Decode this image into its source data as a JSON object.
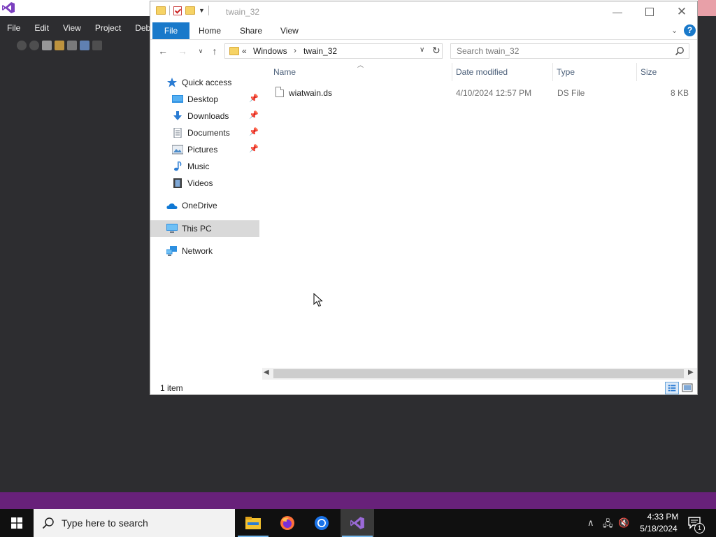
{
  "vs": {
    "menu": [
      "File",
      "Edit",
      "View",
      "Project",
      "Debu"
    ]
  },
  "explorer": {
    "title": "twain_32",
    "ribbon_tabs": [
      "File",
      "Home",
      "Share",
      "View"
    ],
    "help": "?",
    "address": {
      "overflow": "«",
      "segments": [
        "Windows",
        "twain_32"
      ],
      "separator": "›"
    },
    "search_placeholder": "Search twain_32",
    "nav_pane": [
      {
        "label": "Quick access",
        "icon": "star-icon",
        "pinned": false
      },
      {
        "label": "Desktop",
        "icon": "desktop-icon",
        "pinned": true
      },
      {
        "label": "Downloads",
        "icon": "download-icon",
        "pinned": true
      },
      {
        "label": "Documents",
        "icon": "documents-icon",
        "pinned": true
      },
      {
        "label": "Pictures",
        "icon": "pictures-icon",
        "pinned": true
      },
      {
        "label": "Music",
        "icon": "music-icon",
        "pinned": false
      },
      {
        "label": "Videos",
        "icon": "videos-icon",
        "pinned": false
      },
      {
        "label": "OneDrive",
        "icon": "cloud-icon",
        "pinned": false
      },
      {
        "label": "This PC",
        "icon": "computer-icon",
        "pinned": false,
        "selected": true
      },
      {
        "label": "Network",
        "icon": "network-icon",
        "pinned": false
      }
    ],
    "columns": [
      "Name",
      "Date modified",
      "Type",
      "Size"
    ],
    "files": [
      {
        "name": "wiatwain.ds",
        "date": "4/10/2024 12:57 PM",
        "type": "DS File",
        "size": "8 KB"
      }
    ],
    "status": "1 item"
  },
  "taskbar": {
    "search_placeholder": "Type here to search",
    "apps": [
      "file-explorer-icon",
      "firefox-icon",
      "chrome-icon",
      "visual-studio-icon"
    ],
    "time": "4:33 PM",
    "date": "5/18/2024",
    "notification_count": "1"
  },
  "colors": {
    "accent": "#1979ca",
    "vs_purple": "#68217a",
    "vs_dark": "#2d2d30",
    "taskbar": "#101010"
  }
}
